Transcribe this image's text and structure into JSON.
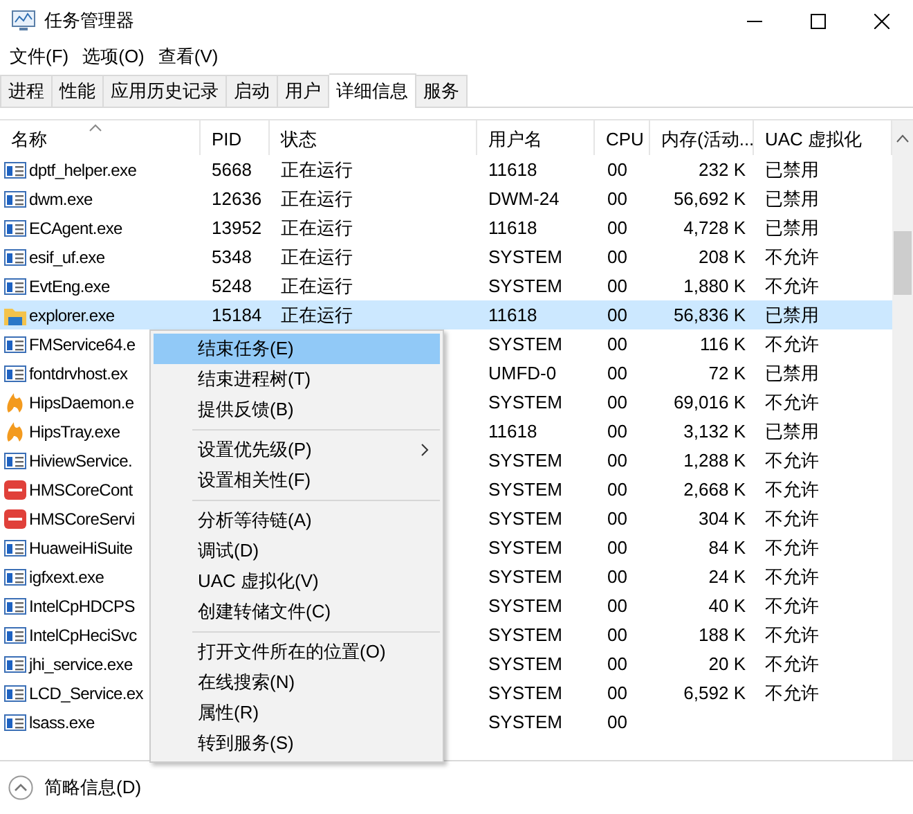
{
  "window": {
    "title": "任务管理器"
  },
  "menu_bar": [
    "文件(F)",
    "选项(O)",
    "查看(V)"
  ],
  "tabs": [
    {
      "label": "进程",
      "selected": false
    },
    {
      "label": "性能",
      "selected": false
    },
    {
      "label": "应用历史记录",
      "selected": false
    },
    {
      "label": "启动",
      "selected": false
    },
    {
      "label": "用户",
      "selected": false
    },
    {
      "label": "详细信息",
      "selected": true
    },
    {
      "label": "服务",
      "selected": false
    }
  ],
  "table": {
    "columns": [
      {
        "label": "名称",
        "sorted": true
      },
      {
        "label": "PID"
      },
      {
        "label": "状态"
      },
      {
        "label": "用户名"
      },
      {
        "label": "CPU"
      },
      {
        "label": "内存(活动..."
      },
      {
        "label": "UAC 虚拟化"
      }
    ],
    "rows": [
      {
        "kind": "app",
        "name": "dptf_helper.exe",
        "pid": "5668",
        "status": "正在运行",
        "user": "11618",
        "cpu": "00",
        "memory": "232 K",
        "uac": "已禁用",
        "selected": false
      },
      {
        "kind": "app",
        "name": "dwm.exe",
        "pid": "12636",
        "status": "正在运行",
        "user": "DWM-24",
        "cpu": "00",
        "memory": "56,692 K",
        "uac": "已禁用",
        "selected": false
      },
      {
        "kind": "app",
        "name": "ECAgent.exe",
        "pid": "13952",
        "status": "正在运行",
        "user": "11618",
        "cpu": "00",
        "memory": "4,728 K",
        "uac": "已禁用",
        "selected": false
      },
      {
        "kind": "app",
        "name": "esif_uf.exe",
        "pid": "5348",
        "status": "正在运行",
        "user": "SYSTEM",
        "cpu": "00",
        "memory": "208 K",
        "uac": "不允许",
        "selected": false
      },
      {
        "kind": "app",
        "name": "EvtEng.exe",
        "pid": "5248",
        "status": "正在运行",
        "user": "SYSTEM",
        "cpu": "00",
        "memory": "1,880 K",
        "uac": "不允许",
        "selected": false
      },
      {
        "kind": "folder",
        "name": "explorer.exe",
        "pid": "15184",
        "status": "正在运行",
        "user": "11618",
        "cpu": "00",
        "memory": "56,836 K",
        "uac": "已禁用",
        "selected": true
      },
      {
        "kind": "app",
        "name": "FMService64.e",
        "user": "SYSTEM",
        "cpu": "00",
        "memory": "116 K",
        "uac": "不允许",
        "selected": false
      },
      {
        "kind": "app",
        "name": "fontdrvhost.ex",
        "user": "UMFD-0",
        "cpu": "00",
        "memory": "72 K",
        "uac": "已禁用",
        "selected": false
      },
      {
        "kind": "flame",
        "name": "HipsDaemon.e",
        "user": "SYSTEM",
        "cpu": "00",
        "memory": "69,016 K",
        "uac": "不允许",
        "selected": false
      },
      {
        "kind": "flame",
        "name": "HipsTray.exe",
        "user": "11618",
        "cpu": "00",
        "memory": "3,132 K",
        "uac": "已禁用",
        "selected": false
      },
      {
        "kind": "app",
        "name": "HiviewService.",
        "user": "SYSTEM",
        "cpu": "00",
        "memory": "1,288 K",
        "uac": "不允许",
        "selected": false
      },
      {
        "kind": "badge",
        "name": "HMSCoreCont",
        "user": "SYSTEM",
        "cpu": "00",
        "memory": "2,668 K",
        "uac": "不允许",
        "selected": false
      },
      {
        "kind": "badge",
        "name": "HMSCoreServi",
        "user": "SYSTEM",
        "cpu": "00",
        "memory": "304 K",
        "uac": "不允许",
        "selected": false
      },
      {
        "kind": "app",
        "name": "HuaweiHiSuite",
        "user": "SYSTEM",
        "cpu": "00",
        "memory": "84 K",
        "uac": "不允许",
        "selected": false
      },
      {
        "kind": "app",
        "name": "igfxext.exe",
        "user": "SYSTEM",
        "cpu": "00",
        "memory": "24 K",
        "uac": "不允许",
        "selected": false
      },
      {
        "kind": "app",
        "name": "IntelCpHDCPS",
        "user": "SYSTEM",
        "cpu": "00",
        "memory": "40 K",
        "uac": "不允许",
        "selected": false
      },
      {
        "kind": "app",
        "name": "IntelCpHeciSvc",
        "user": "SYSTEM",
        "cpu": "00",
        "memory": "188 K",
        "uac": "不允许",
        "selected": false
      },
      {
        "kind": "app",
        "name": "jhi_service.exe",
        "user": "SYSTEM",
        "cpu": "00",
        "memory": "20 K",
        "uac": "不允许",
        "selected": false
      },
      {
        "kind": "app",
        "name": "LCD_Service.ex",
        "user": "SYSTEM",
        "cpu": "00",
        "memory": "6,592 K",
        "uac": "不允许",
        "selected": false
      },
      {
        "kind": "app",
        "name": "lsass.exe",
        "user": "SYSTEM",
        "cpu": "00",
        "selected": false
      }
    ]
  },
  "context_menu": {
    "groups": [
      [
        {
          "label": "结束任务(E)",
          "selected": true,
          "submenu": false
        },
        {
          "label": "结束进程树(T)",
          "selected": false,
          "submenu": false
        },
        {
          "label": "提供反馈(B)",
          "selected": false,
          "submenu": false
        }
      ],
      [
        {
          "label": "设置优先级(P)",
          "selected": false,
          "submenu": true
        },
        {
          "label": "设置相关性(F)",
          "selected": false,
          "submenu": false
        }
      ],
      [
        {
          "label": "分析等待链(A)",
          "selected": false,
          "submenu": false
        },
        {
          "label": "调试(D)",
          "selected": false,
          "submenu": false
        },
        {
          "label": "UAC 虚拟化(V)",
          "selected": false,
          "submenu": false
        },
        {
          "label": "创建转储文件(C)",
          "selected": false,
          "submenu": false
        }
      ],
      [
        {
          "label": "打开文件所在的位置(O)",
          "selected": false,
          "submenu": false
        },
        {
          "label": "在线搜索(N)",
          "selected": false,
          "submenu": false
        },
        {
          "label": "属性(R)",
          "selected": false,
          "submenu": false
        },
        {
          "label": "转到服务(S)",
          "selected": false,
          "submenu": false
        }
      ]
    ]
  },
  "status_bar": {
    "label": "简略信息(D)"
  }
}
